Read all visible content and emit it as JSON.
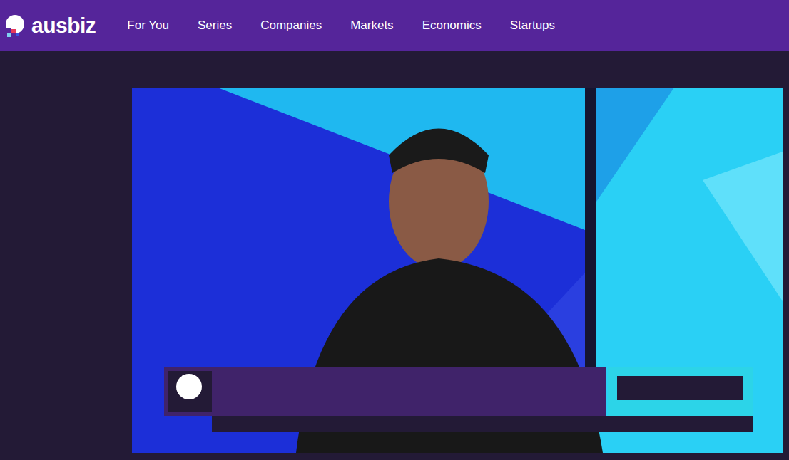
{
  "logo": {
    "text": "ausbiz"
  },
  "nav": [
    {
      "label": "For You",
      "selected": false
    },
    {
      "label": "Series",
      "selected": false
    },
    {
      "label": "Companies",
      "selected": false
    },
    {
      "label": "Markets",
      "selected": false
    },
    {
      "label": "Economics",
      "selected": false
    },
    {
      "label": "Startups",
      "selected": false
    }
  ]
}
